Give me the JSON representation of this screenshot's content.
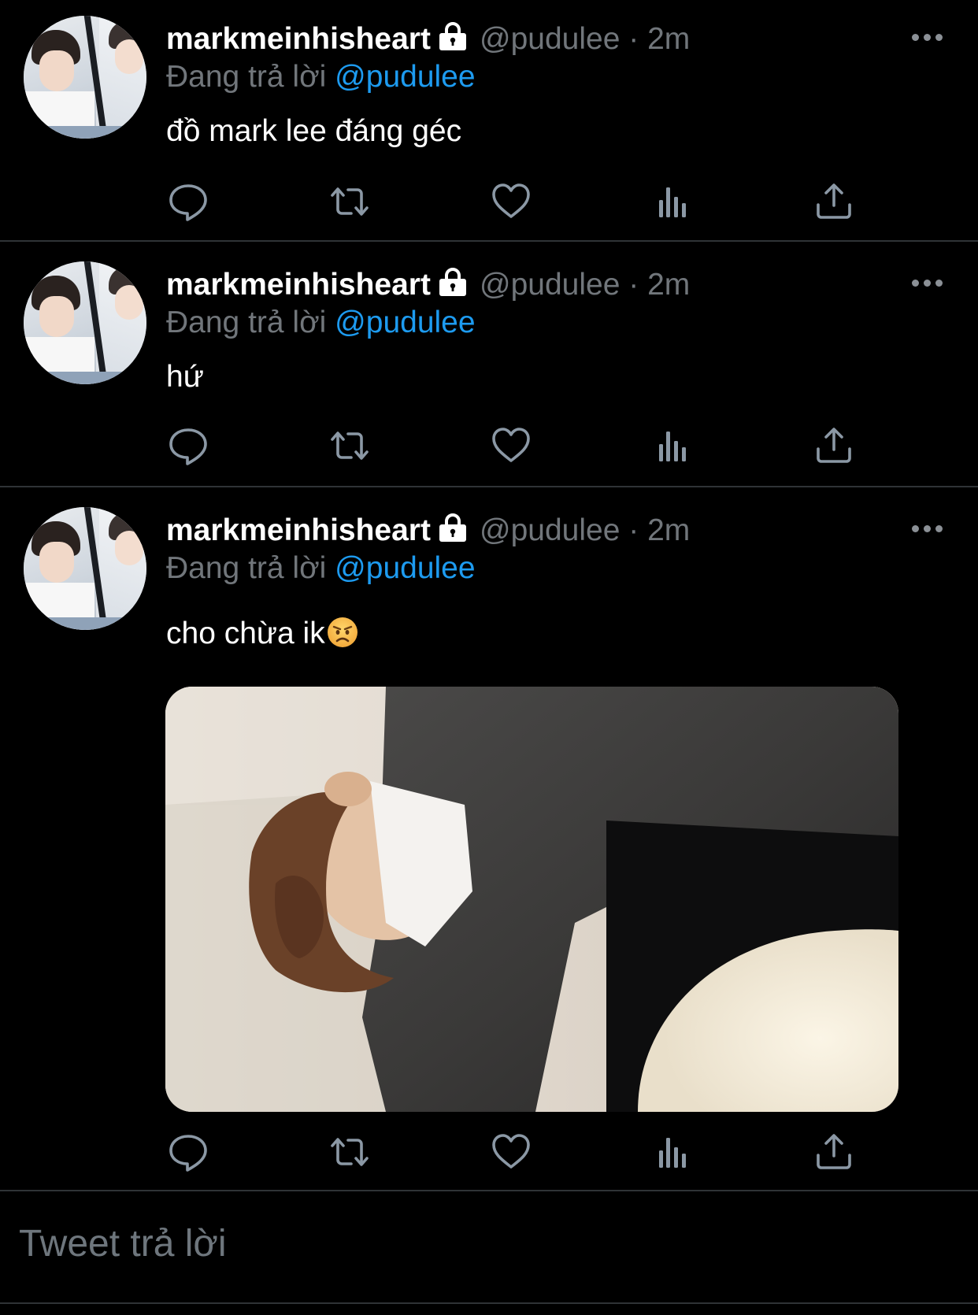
{
  "tweets": [
    {
      "username": "markmeinhisheart",
      "handle": "@pudulee",
      "separator": "·",
      "time": "2m",
      "replying_prefix": "Đang trả lời",
      "replying_to": "@pudulee",
      "text": "đồ mark lee đáng géc"
    },
    {
      "username": "markmeinhisheart",
      "handle": "@pudulee",
      "separator": "·",
      "time": "2m",
      "replying_prefix": "Đang trả lời",
      "replying_to": "@pudulee",
      "text": "hứ"
    },
    {
      "username": "markmeinhisheart",
      "handle": "@pudulee",
      "separator": "·",
      "time": "2m",
      "replying_prefix": "Đang trả lời",
      "replying_to": "@pudulee",
      "text": "cho chừa ik",
      "emoji": "angry-face"
    }
  ],
  "icons": {
    "reply": "comment-bubble-icon",
    "retweet": "retweet-icon",
    "like": "heart-icon",
    "analytics": "bar-chart-icon",
    "share": "share-upload-icon",
    "lock": "lock-icon",
    "more": "more-dots-icon"
  },
  "reply_box": {
    "placeholder": "Tweet trả lời"
  },
  "colors": {
    "background": "#000000",
    "text": "#ffffff",
    "secondary": "#71767b",
    "link": "#1d9bf0",
    "divider": "#2f3336",
    "icon": "#8b98a5"
  }
}
